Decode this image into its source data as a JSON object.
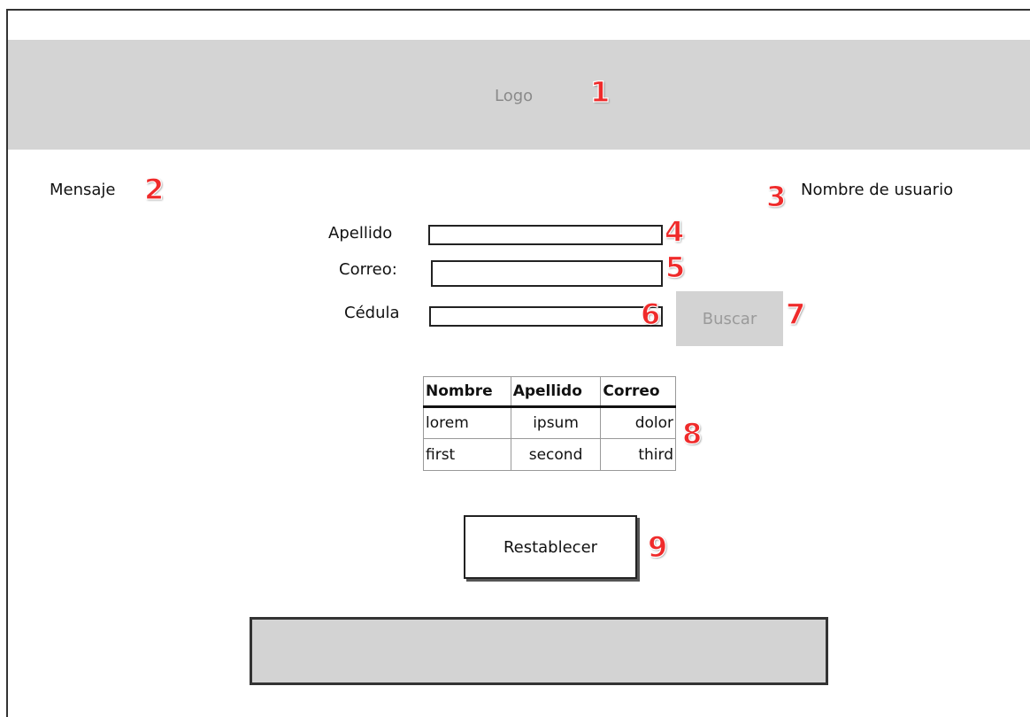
{
  "header": {
    "logo_text": "Logo",
    "marker": "1"
  },
  "message": {
    "label": "Mensaje",
    "marker": "2"
  },
  "user": {
    "label": "Nombre de usuario",
    "marker": "3"
  },
  "form": {
    "apellido": {
      "label": "Apellido",
      "value": "",
      "marker": "4"
    },
    "correo": {
      "label": "Correo:",
      "value": "",
      "marker": "5"
    },
    "cedula": {
      "label": "Cédula",
      "value": "",
      "marker": "6"
    },
    "search_button": {
      "label": "Buscar",
      "marker": "7"
    }
  },
  "table": {
    "marker": "8",
    "columns": [
      "Nombre",
      "Apellido",
      "Correo"
    ],
    "rows": [
      [
        "lorem",
        "ipsum",
        "dolor"
      ],
      [
        "first",
        "second",
        "third"
      ]
    ]
  },
  "reset_button": {
    "label": "Restablecer",
    "marker": "9"
  }
}
